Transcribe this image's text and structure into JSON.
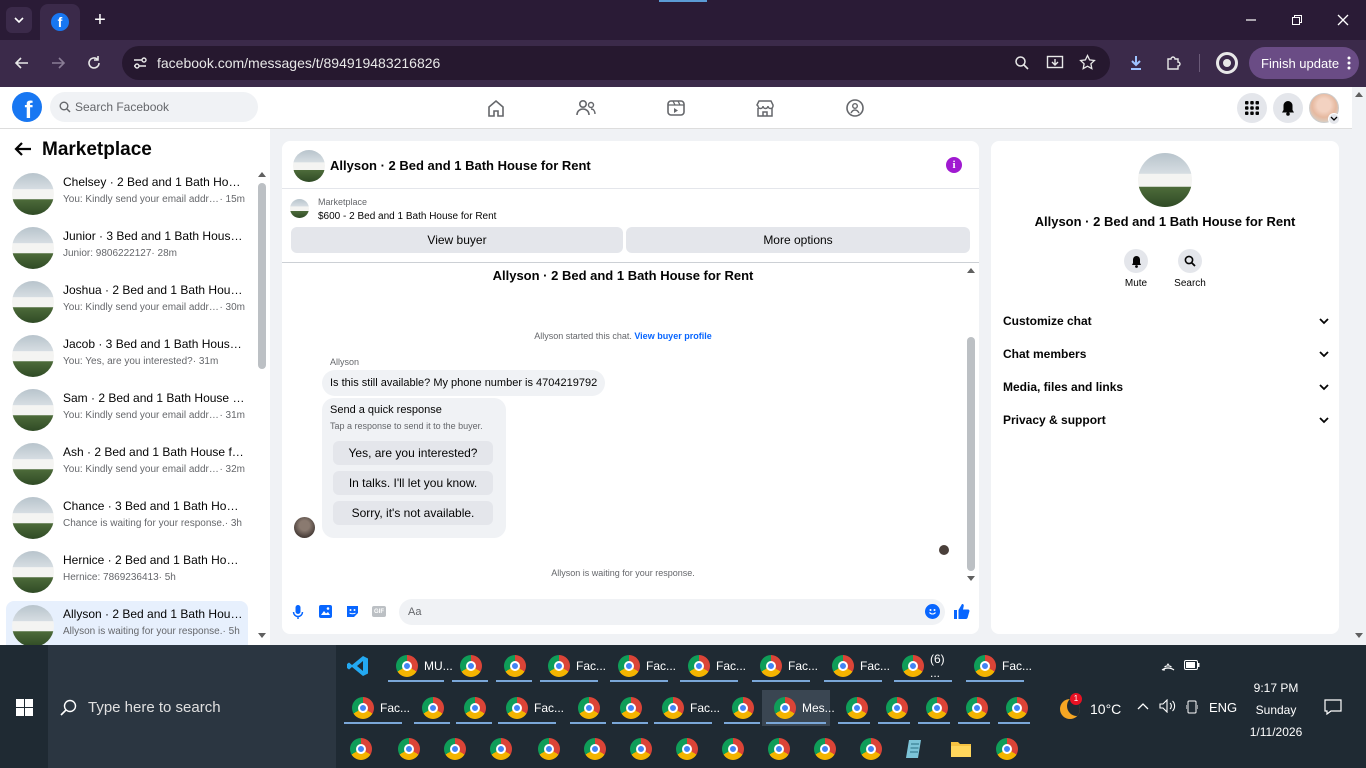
{
  "browser": {
    "tab_plus": "+",
    "url": "facebook.com/messages/t/894919483216826",
    "finish_update": "Finish update"
  },
  "fbnav": {
    "search_placeholder": "Search Facebook"
  },
  "sidebar": {
    "title": "Marketplace",
    "items": [
      {
        "name": "Chelsey · 2 Bed and 1 Bath House for Rent",
        "preview": "You: Kindly send your email address",
        "time": "· 15m"
      },
      {
        "name": "Junior · 3 Bed and 1 Bath House for Rent",
        "preview": "Junior: 9806222127",
        "time": " · 28m"
      },
      {
        "name": "Joshua · 2 Bed and 1 Bath House for Rent",
        "preview": "You: Kindly send your email address",
        "time": "· 30m"
      },
      {
        "name": "Jacob · 3 Bed and 1 Bath House for Rent",
        "preview": "You: Yes, are you interested?",
        "time": " · 31m"
      },
      {
        "name": "Sam · 2 Bed and 1 Bath House for Rent",
        "preview": "You: Kindly send your email address",
        "time": "· 31m"
      },
      {
        "name": "Ash · 2 Bed and 1 Bath House for Rent",
        "preview": "You: Kindly send your email address",
        "time": "· 32m"
      },
      {
        "name": "Chance · 3 Bed and 1 Bath House for Rent",
        "preview": "Chance is waiting for your response.",
        "time": " · 3h"
      },
      {
        "name": "Hernice · 2 Bed and 1 Bath House for Rent",
        "preview": "Hernice: 7869236413",
        "time": " · 5h"
      },
      {
        "name": "Allyson · 2 Bed and 1 Bath House for Rent",
        "preview": "Allyson is waiting for your response.",
        "time": " · 5h"
      }
    ]
  },
  "chat": {
    "header_title": "Allyson · 2 Bed and 1 Bath House for Rent",
    "listing_source": "Marketplace",
    "listing_title": "$600 - 2 Bed and 1 Bath House for Rent",
    "view_buyer": "View buyer",
    "more_options": "More options",
    "thread_title": "Allyson · 2 Bed and 1 Bath House for Rent",
    "started_text": "Allyson started this chat.",
    "view_buyer_profile": "View buyer profile",
    "sender": "Allyson",
    "message": "Is this still available? My phone number is 4704219792",
    "quick_title": "Send a quick response",
    "quick_sub": "Tap a response to send it to the buyer.",
    "quick_responses": [
      "Yes, are you interested?",
      "In talks. I'll let you know.",
      "Sorry, it's not available."
    ],
    "waiting": "Allyson is waiting for your response.",
    "composer_placeholder": "Aa",
    "gif_label": "GIF"
  },
  "info": {
    "title": "Allyson · 2 Bed and 1 Bath House for Rent",
    "mute": "Mute",
    "search": "Search",
    "sections": [
      "Customize chat",
      "Chat members",
      "Media, files and links",
      "Privacy & support"
    ]
  },
  "taskbar": {
    "search_placeholder": "Type here to search",
    "row1": [
      "",
      "MU...",
      "",
      "",
      "Fac...",
      "Fac...",
      "Fac...",
      "Fac...",
      "Fac...",
      "(6) ...",
      "Fac..."
    ],
    "row2": [
      "Fac...",
      "",
      "",
      "Fac...",
      "",
      "",
      "Fac...",
      "",
      "Mes...",
      "",
      "",
      "",
      "",
      ""
    ],
    "weather": "10°C",
    "lang": "ENG",
    "time": "9:17 PM",
    "day": "Sunday",
    "date": "1/11/2026",
    "badge": "1"
  }
}
